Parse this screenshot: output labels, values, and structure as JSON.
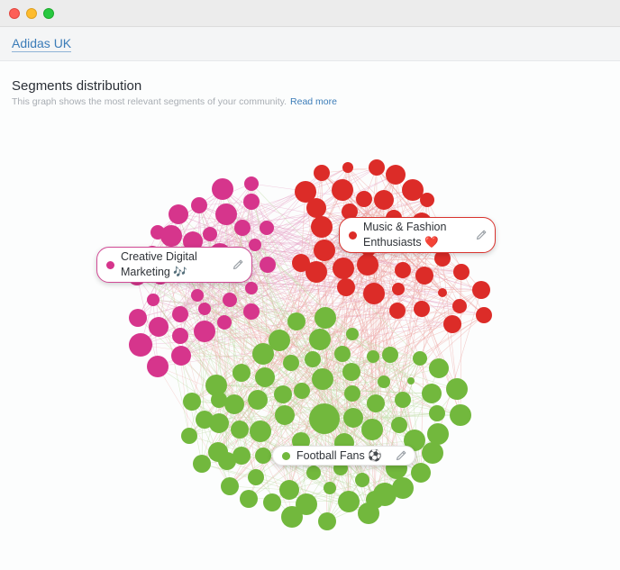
{
  "window": {
    "controls": [
      "close",
      "minimize",
      "maximize"
    ]
  },
  "header": {
    "brand_link": "Adidas UK"
  },
  "section": {
    "title": "Segments distribution",
    "subtitle": "This graph shows the most relevant segments of your community.",
    "read_more": "Read more"
  },
  "segments": [
    {
      "id": "creative",
      "label_line1": "Creative Digital",
      "label_line2": "Marketing 🎶",
      "color": "#d6358c"
    },
    {
      "id": "music",
      "label_line1": "Music & Fashion",
      "label_line2": "Enthusiasts ❤️",
      "color": "#dc2c28"
    },
    {
      "id": "football",
      "label_line1": "Football Fans ⚽",
      "color": "#72b83d"
    }
  ],
  "icons": {
    "edit": "pencil-icon",
    "segment_dot": "dot-icon"
  },
  "colors": {
    "accent_link": "#3b7cb8",
    "creative": "#d6358c",
    "music": "#dc2c28",
    "football": "#72b83d",
    "edge_pink": "#e7a6c9",
    "edge_red": "#eea09c",
    "edge_green": "#bfdca6"
  }
}
